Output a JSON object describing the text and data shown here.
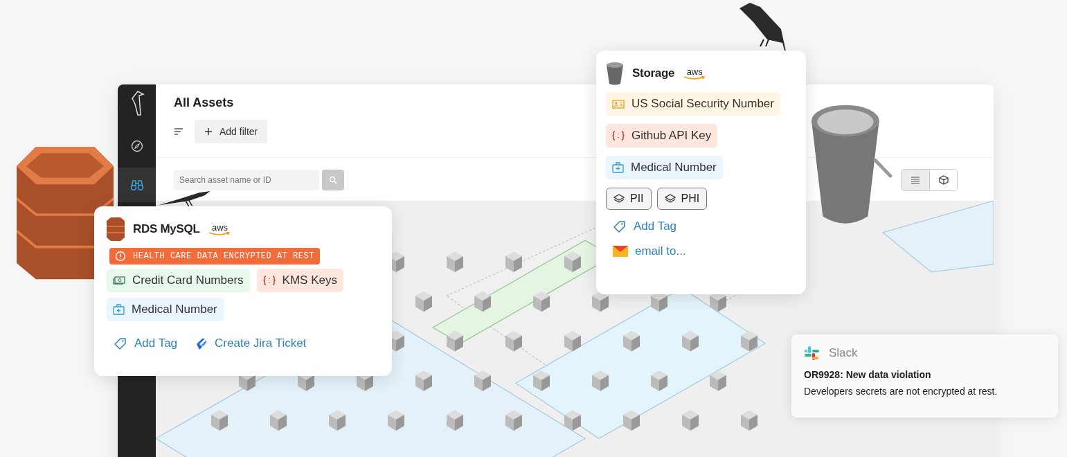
{
  "sidebar": {
    "items": [
      {
        "kind": "compass",
        "selected": false
      },
      {
        "kind": "binoculars",
        "selected": true
      }
    ]
  },
  "page": {
    "title": "All Assets",
    "add_filter": "Add filter",
    "search": {
      "placeholder": "Search asset name or ID"
    },
    "view_toggle": [
      {
        "kind": "list",
        "selected": true
      },
      {
        "kind": "cube",
        "selected": false
      }
    ]
  },
  "asset_cards": [
    {
      "kind": "database",
      "name": "RDS MySQL",
      "provider": "aws",
      "alert": "HEALTH CARE DATA ENCRYPTED AT REST",
      "tags": [
        {
          "kind": "card",
          "label": "Credit Card Numbers"
        },
        {
          "kind": "key",
          "label": "KMS Keys"
        },
        {
          "kind": "medical",
          "label": "Medical Number"
        }
      ],
      "actions": [
        {
          "kind": "tag",
          "label": "Add Tag"
        },
        {
          "kind": "ticket",
          "label": "Create Jira Ticket"
        }
      ]
    },
    {
      "kind": "bucket",
      "name": "Storage",
      "provider": "aws",
      "tags": [
        {
          "kind": "ssn",
          "label": "US Social Security Number"
        },
        {
          "kind": "key",
          "label": "Github API Key"
        },
        {
          "kind": "medical",
          "label": "Medical Number"
        }
      ],
      "labels": [
        "PII",
        "PHI"
      ],
      "actions": [
        {
          "kind": "tag",
          "label": "Add Tag"
        },
        {
          "kind": "email",
          "label": "email to..."
        }
      ]
    }
  ],
  "notification": {
    "app": "Slack",
    "title": "OR9928: New data violation",
    "message": "Developers secrets are not encrypted at rest."
  }
}
